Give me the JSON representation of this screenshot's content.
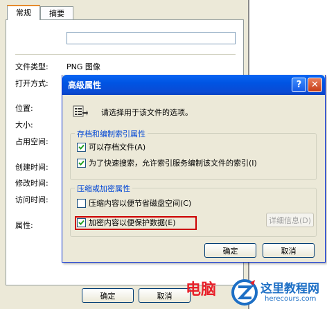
{
  "props_window": {
    "tabs": [
      "常规",
      "摘要"
    ],
    "labels": {
      "file_type": "文件类型:",
      "open_with": "打开方式:",
      "location": "位置:",
      "size": "大小:",
      "size_on_disk": "占用空间:",
      "created": "创建时间:",
      "modified": "修改时间:",
      "accessed": "访问时间:",
      "attributes": "属性:"
    },
    "file_type_value": "PNG 图像",
    "buttons": {
      "ok": "确定",
      "cancel": "取消"
    }
  },
  "dialog": {
    "title": "高级属性",
    "help_glyph": "?",
    "close_glyph": "✕",
    "intro": "请选择用于该文件的选项。",
    "archive_group": {
      "title": "存档和编制索引属性",
      "options": [
        {
          "label": "可以存档文件(A)",
          "checked": true
        },
        {
          "label": "为了快速搜索，允许索引服务编制该文件的索引(I)",
          "checked": true
        }
      ]
    },
    "compress_group": {
      "title": "压缩或加密属性",
      "options": [
        {
          "label": "压缩内容以便节省磁盘空间(C)",
          "checked": false
        },
        {
          "label": "加密内容以便保护数据(E)",
          "checked": true
        }
      ],
      "details_button": "详细信息(D)"
    },
    "ok": "确定",
    "cancel": "取消",
    "highlight_color": "#cc0000"
  },
  "watermark": {
    "overlay_text": "电脑",
    "site_name": "这里教程网",
    "site_url": "herecours.com"
  }
}
